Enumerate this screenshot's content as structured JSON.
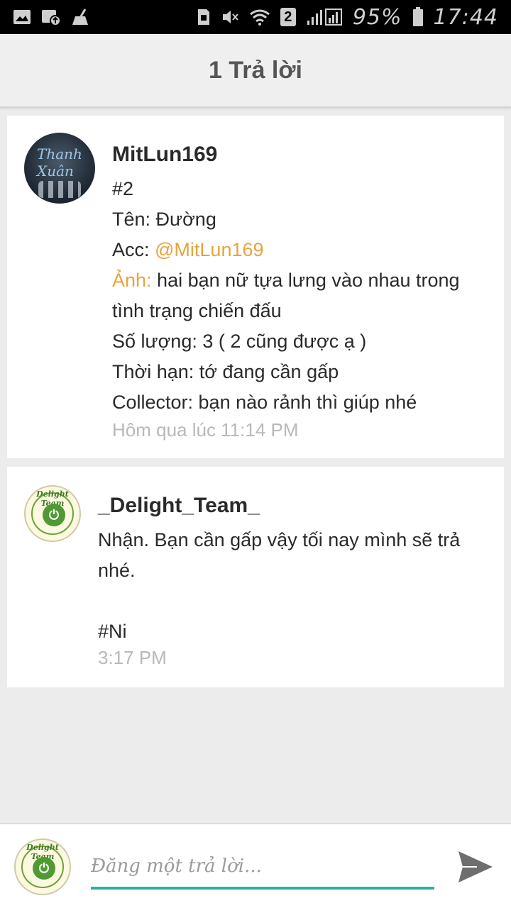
{
  "status_bar": {
    "sim_badge": "2",
    "battery": "95%",
    "time": "17:44"
  },
  "header": {
    "title": "1 Trả lời"
  },
  "posts": [
    {
      "author": "MitLun169",
      "avatar_text": "Thanh Xuân",
      "lines": {
        "number": "#2",
        "name": "Tên: Đường",
        "acc_label": "Acc: ",
        "acc_value": "@MitLun169",
        "image_label": "Ảnh:",
        "image_value": " hai bạn nữ tựa lưng vào nhau trong tình trạng chiến đấu",
        "quantity": "Số lượng: 3 ( 2 cũng được ạ )",
        "deadline": "Thời hạn: tớ đang cần gấp",
        "collector": "Collector:  bạn nào rảnh thì giúp nhé"
      },
      "timestamp": "Hôm qua lúc 11:14 PM"
    },
    {
      "author": "_Delight_Team_",
      "lines": {
        "message": "Nhận. Bạn cần gấp vậy tối nay mình sẽ trả nhé.",
        "signature": "#Ni"
      },
      "timestamp": "3:17 PM"
    }
  ],
  "logo": {
    "text": "Delight Team",
    "plug_glyph": "⏻"
  },
  "reply": {
    "placeholder": "Đăng một trả lời...",
    "value": ""
  },
  "colors": {
    "accent_orange": "#e8a33d",
    "input_underline": "#2ab0a8",
    "timestamp_gray": "#b8b8b8"
  }
}
